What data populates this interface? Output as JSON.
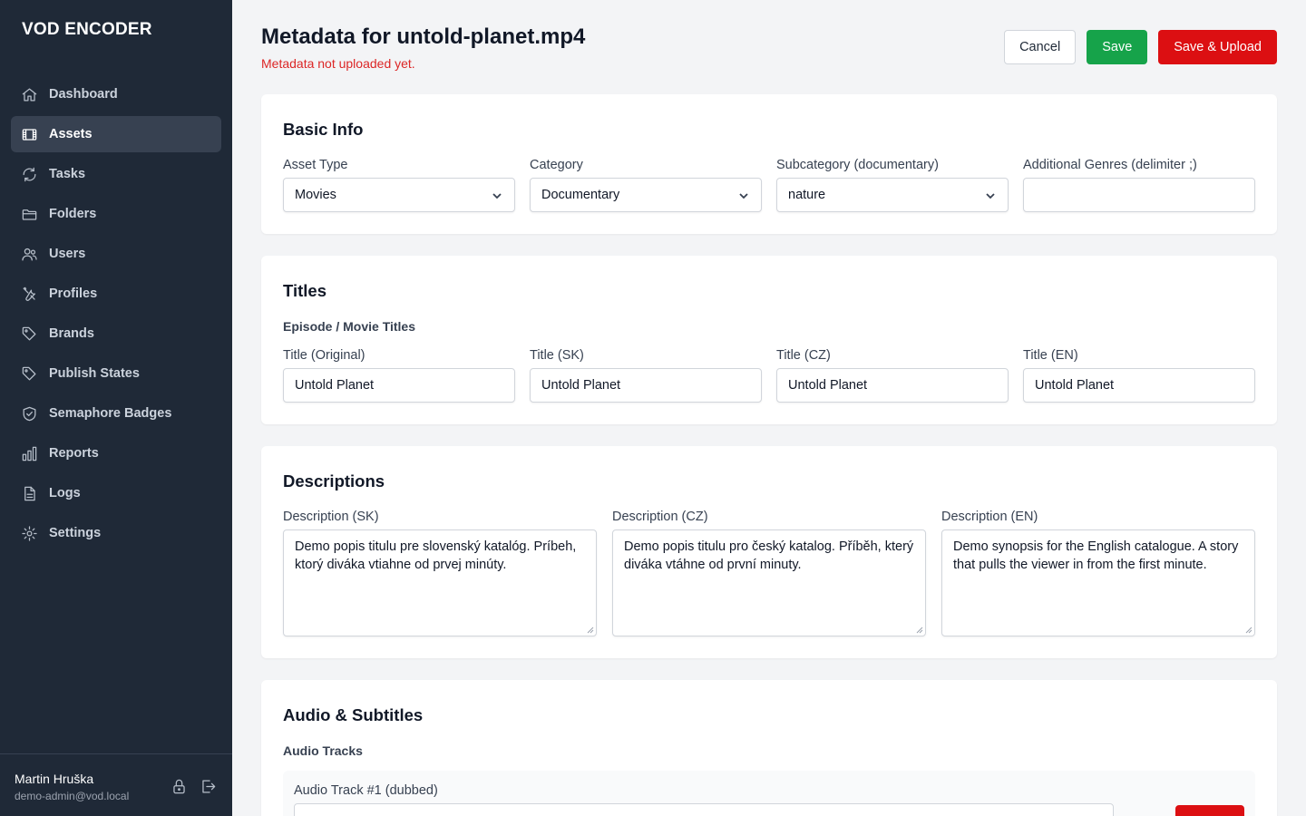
{
  "app": {
    "brand": "VOD ENCODER"
  },
  "sidebar": {
    "items": [
      {
        "label": "Dashboard",
        "icon": "home-icon"
      },
      {
        "label": "Assets",
        "icon": "film-icon",
        "active": true
      },
      {
        "label": "Tasks",
        "icon": "refresh-icon"
      },
      {
        "label": "Folders",
        "icon": "folder-icon"
      },
      {
        "label": "Users",
        "icon": "users-icon"
      },
      {
        "label": "Profiles",
        "icon": "tools-icon"
      },
      {
        "label": "Brands",
        "icon": "tag-icon"
      },
      {
        "label": "Publish States",
        "icon": "tag-icon"
      },
      {
        "label": "Semaphore Badges",
        "icon": "shield-icon"
      },
      {
        "label": "Reports",
        "icon": "bar-chart-icon"
      },
      {
        "label": "Logs",
        "icon": "document-icon"
      },
      {
        "label": "Settings",
        "icon": "gear-icon"
      }
    ],
    "user": {
      "name": "Martin Hruška",
      "email": "demo-admin@vod.local"
    }
  },
  "header": {
    "title": "Metadata for untold-planet.mp4",
    "status": "Metadata not uploaded yet.",
    "cancel_label": "Cancel",
    "save_label": "Save",
    "save_upload_label": "Save & Upload"
  },
  "basic_info": {
    "title": "Basic Info",
    "asset_type": {
      "label": "Asset Type",
      "value": "Movies"
    },
    "category": {
      "label": "Category",
      "value": "Documentary"
    },
    "subcategory": {
      "label": "Subcategory (documentary)",
      "value": "nature"
    },
    "genres": {
      "label": "Additional Genres (delimiter ;)",
      "value": ""
    }
  },
  "titles": {
    "title": "Titles",
    "subhead": "Episode / Movie Titles",
    "fields": [
      {
        "label": "Title (Original)",
        "value": "Untold Planet"
      },
      {
        "label": "Title (SK)",
        "value": "Untold Planet"
      },
      {
        "label": "Title (CZ)",
        "value": "Untold Planet"
      },
      {
        "label": "Title (EN)",
        "value": "Untold Planet"
      }
    ]
  },
  "descriptions": {
    "title": "Descriptions",
    "fields": [
      {
        "label": "Description (SK)",
        "value": "Demo popis titulu pre slovenský katalóg. Príbeh, ktorý diváka vtiahne od prvej minúty."
      },
      {
        "label": "Description (CZ)",
        "value": "Demo popis titulu pro český katalog. Příběh, který diváka vtáhne od první minuty."
      },
      {
        "label": "Description (EN)",
        "value": "Demo synopsis for the English catalogue. A story that pulls the viewer in from the first minute."
      }
    ]
  },
  "audio": {
    "title": "Audio & Subtitles",
    "subhead": "Audio Tracks",
    "track_label": "Audio Track #1 (dubbed)"
  },
  "colors": {
    "sidebar": "#1f2937",
    "save": "#16a34a",
    "danger": "#dc0f12",
    "status": "#dc2626"
  }
}
